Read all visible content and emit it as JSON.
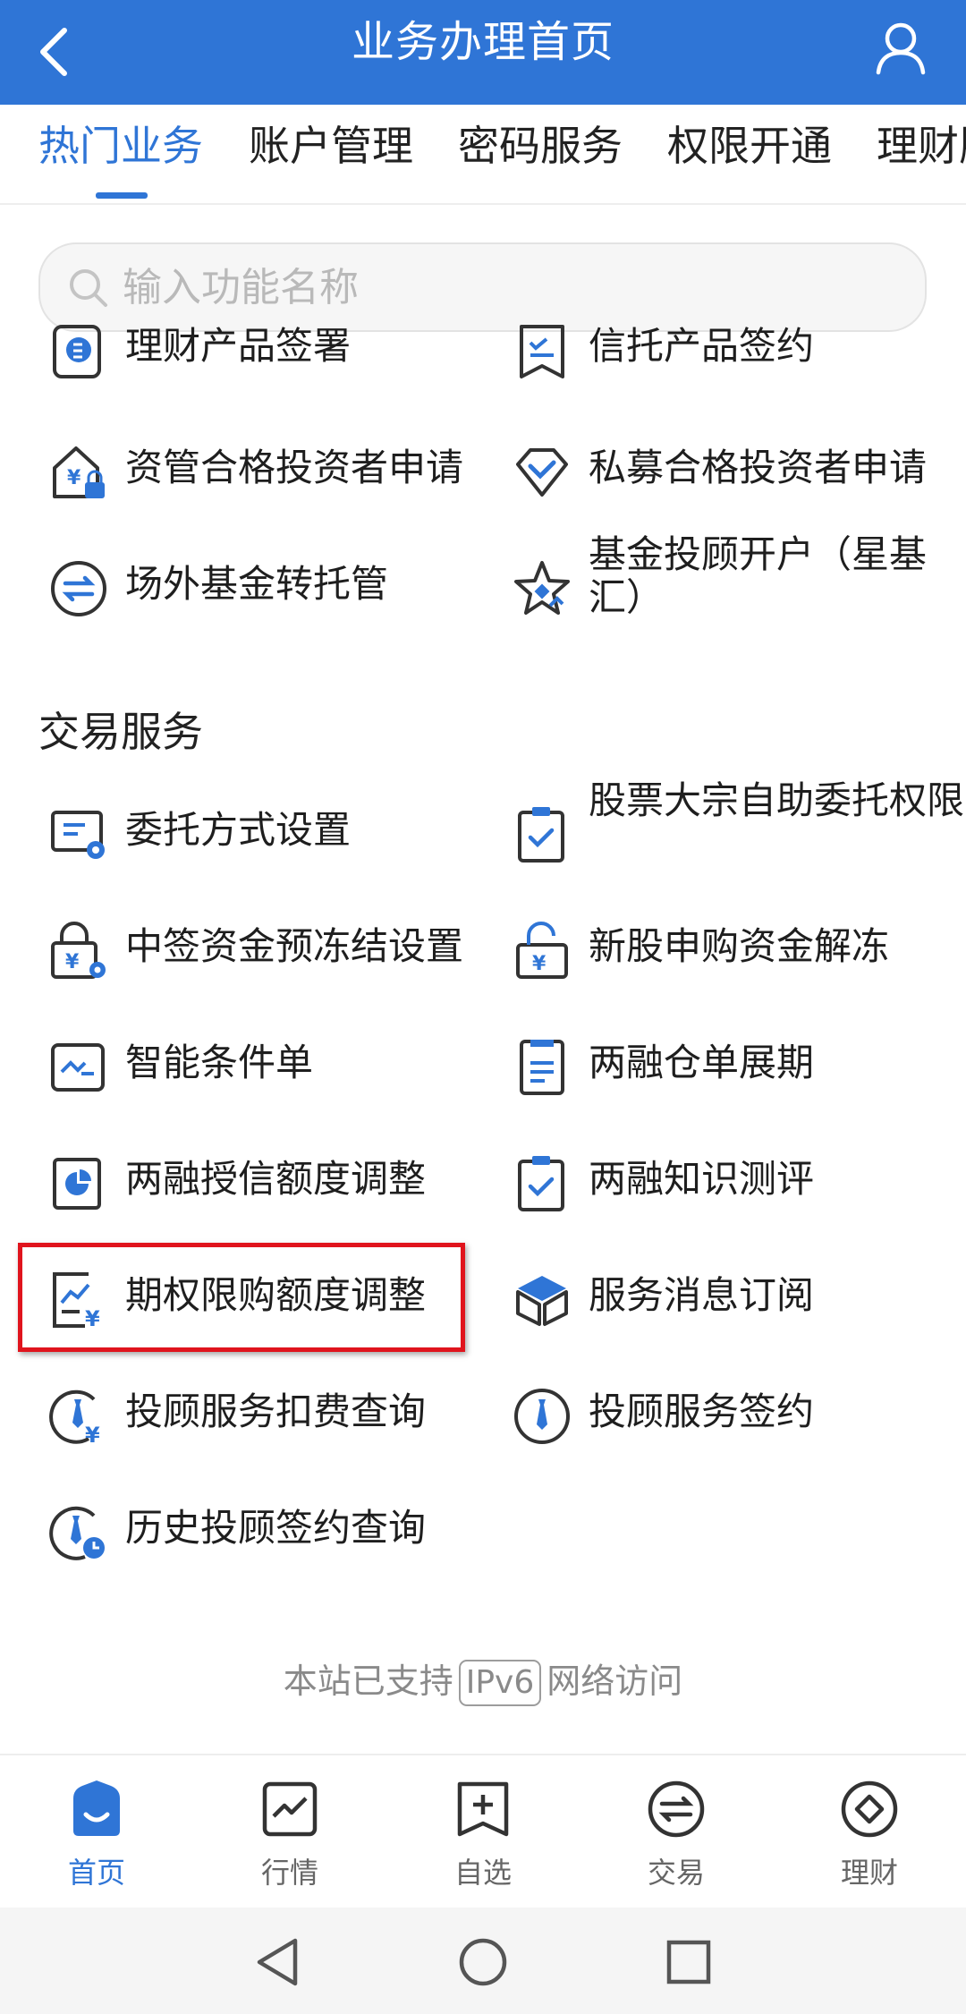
{
  "header": {
    "title": "业务办理首页"
  },
  "tabs": [
    {
      "label": "热门业务",
      "active": true
    },
    {
      "label": "账户管理",
      "active": false
    },
    {
      "label": "密码服务",
      "active": false
    },
    {
      "label": "权限开通",
      "active": false
    },
    {
      "label": "理财服",
      "active": false
    }
  ],
  "search": {
    "placeholder": "输入功能名称",
    "value": ""
  },
  "top_items": [
    {
      "label": "理财产品签署",
      "icon": "finance-product-icon"
    },
    {
      "label": "信托产品签约",
      "icon": "trust-bookmark-icon"
    },
    {
      "label": "资管合格投资者申请",
      "icon": "house-yuan-lock-icon"
    },
    {
      "label": "私募合格投资者申请",
      "icon": "diamond-check-icon"
    },
    {
      "label": "场外基金转托管",
      "icon": "transfer-circle-icon"
    },
    {
      "label": "基金投顾开户（星基汇）",
      "icon": "star-icon"
    }
  ],
  "section": {
    "title": "交易服务"
  },
  "trade_items": [
    {
      "label": "委托方式设置",
      "icon": "screen-gear-icon"
    },
    {
      "label": "股票大宗自助委托权限",
      "icon": "clipboard-check-icon"
    },
    {
      "label": "中签资金预冻结设置",
      "icon": "lock-yuan-gear-icon"
    },
    {
      "label": "新股申购资金解冻",
      "icon": "unlock-yuan-icon"
    },
    {
      "label": "智能条件单",
      "icon": "smart-order-icon"
    },
    {
      "label": "两融仓单展期",
      "icon": "document-icon"
    },
    {
      "label": "两融授信额度调整",
      "icon": "pie-document-icon"
    },
    {
      "label": "两融知识测评",
      "icon": "clipboard-check-icon"
    },
    {
      "label": "期权限购额度调整",
      "icon": "chart-yuan-icon",
      "highlighted": true
    },
    {
      "label": "服务消息订阅",
      "icon": "cube-icon"
    },
    {
      "label": "投顾服务扣费查询",
      "icon": "tie-yuan-icon"
    },
    {
      "label": "投顾服务签约",
      "icon": "tie-circle-icon"
    },
    {
      "label": "历史投顾签约查询",
      "icon": "tie-clock-icon"
    }
  ],
  "footer": {
    "prefix": "本站已支持",
    "badge": "IPv6",
    "suffix": "网络访问"
  },
  "bottom_nav": [
    {
      "label": "首页",
      "icon": "home-icon",
      "active": true
    },
    {
      "label": "行情",
      "icon": "market-chart-icon",
      "active": false
    },
    {
      "label": "自选",
      "icon": "watchlist-add-icon",
      "active": false
    },
    {
      "label": "交易",
      "icon": "trade-exchange-icon",
      "active": false
    },
    {
      "label": "理财",
      "icon": "wealth-icon",
      "active": false
    }
  ],
  "colors": {
    "brand_blue": "#2f75d6",
    "highlight_red": "#e0141d"
  }
}
